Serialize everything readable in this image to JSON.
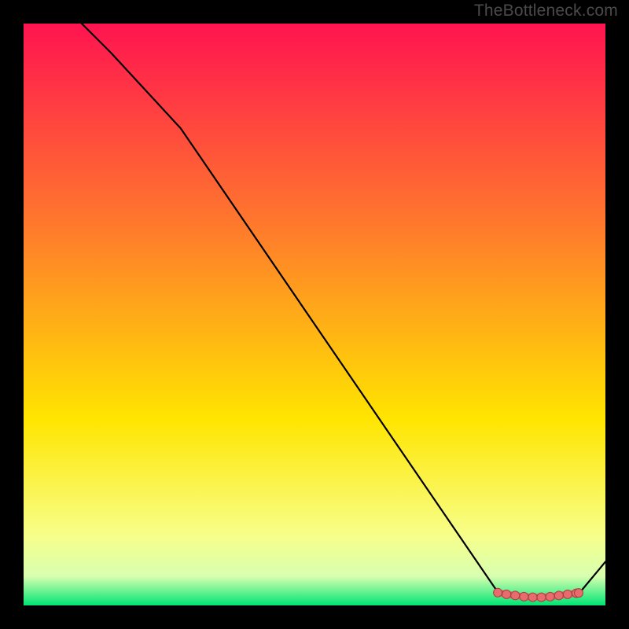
{
  "watermark": "TheBottleneck.com",
  "colors": {
    "page_bg": "#000000",
    "line": "#000000",
    "marker_fill": "#e86b6d",
    "marker_stroke": "#a54142",
    "grad_top": "#ff1450",
    "grad_mid_upper": "#ff7a2c",
    "grad_mid": "#ffe500",
    "grad_lower": "#f7ff8a",
    "grad_band": "#d8ffb0",
    "grad_bottom": "#00e574"
  },
  "chart_data": {
    "type": "line",
    "title": "",
    "xlabel": "",
    "ylabel": "",
    "xlim": [
      0,
      100
    ],
    "ylim": [
      0,
      100
    ],
    "series": [
      {
        "name": "curve",
        "x": [
          0,
          15,
          27,
          81,
          82,
          84,
          86,
          88,
          90,
          92,
          94,
          95.5,
          100
        ],
        "y": [
          110,
          95,
          82,
          3,
          2,
          1.6,
          1.4,
          1.3,
          1.3,
          1.4,
          1.8,
          2.1,
          7.5
        ]
      }
    ],
    "markers": {
      "name": "highlight-cluster",
      "x": [
        81.5,
        83,
        84.5,
        86,
        87.5,
        89,
        90.5,
        92,
        93.5,
        95
      ],
      "y": [
        2.2,
        1.9,
        1.7,
        1.5,
        1.4,
        1.4,
        1.5,
        1.7,
        1.9,
        2.1
      ]
    }
  }
}
